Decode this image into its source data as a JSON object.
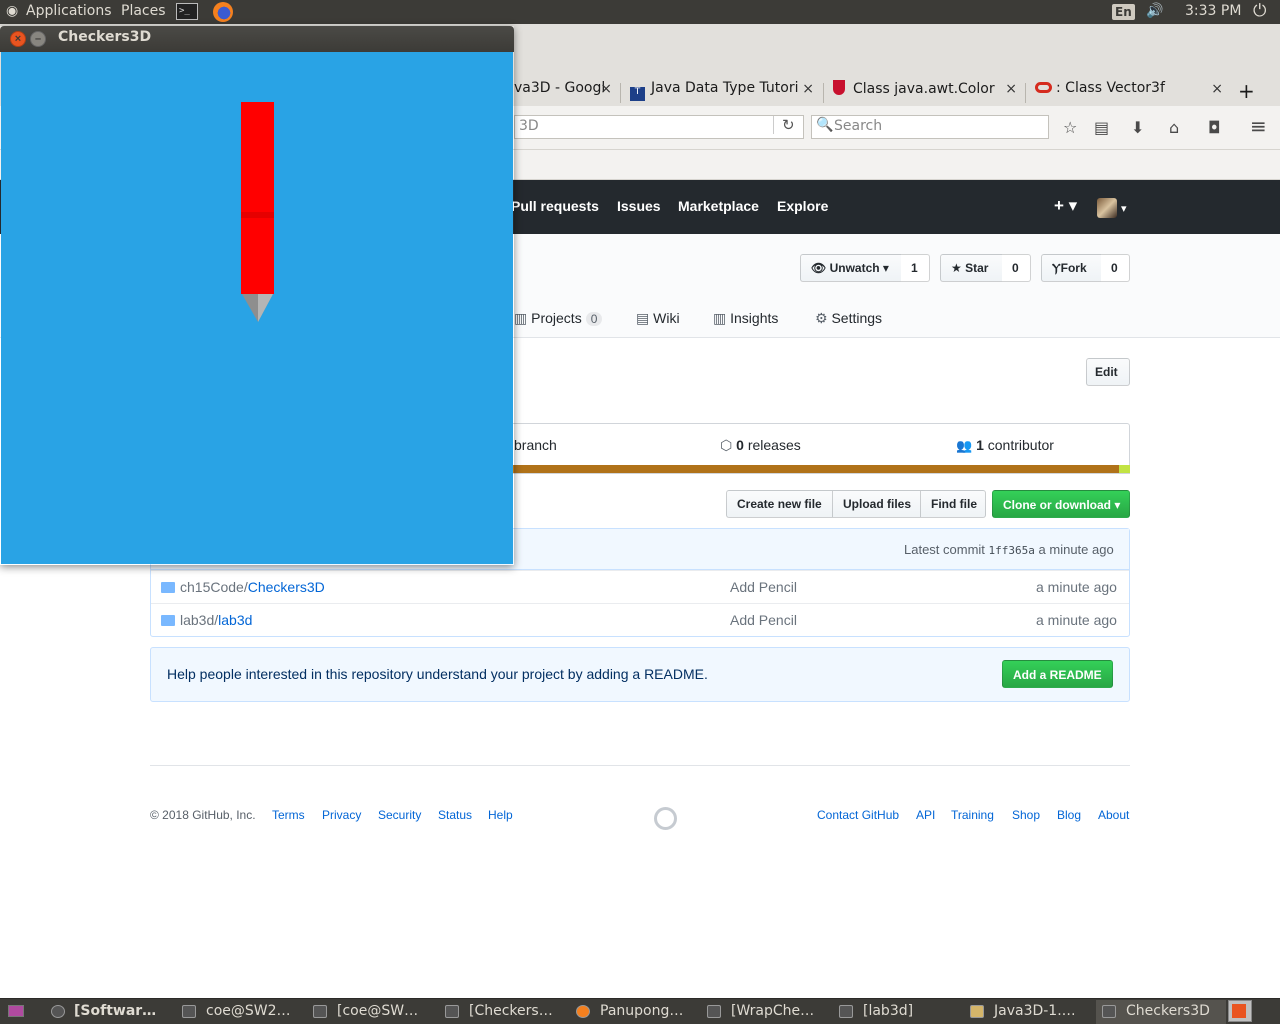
{
  "top_panel": {
    "applications": "Applications",
    "places": "Places",
    "terminal_glyph": ">_",
    "lang": "En",
    "volume_glyph": "🔊",
    "time": "3:33 PM",
    "power_glyph": "⏻"
  },
  "browser": {
    "tabs": [
      {
        "label": "va3D - Googl",
        "close": "×"
      },
      {
        "label": "Java Data Type Tutori",
        "close": "×"
      },
      {
        "label": "Class java.awt.Color",
        "close": "×"
      },
      {
        "label": ": Class Vector3f",
        "close": "×"
      }
    ],
    "new_tab": "+",
    "url_fragment": "3D",
    "reload_glyph": "↻",
    "search_placeholder": "Search",
    "toolbar_glyphs": {
      "star": "☆",
      "reading_list": "▤",
      "download": "⬇",
      "home": "⌂",
      "pocket": "◘",
      "menu": "≡"
    }
  },
  "github": {
    "nav": [
      "Pull requests",
      "Issues",
      "Marketplace",
      "Explore"
    ],
    "plus": "+ ▾",
    "avatar_caret": "▾",
    "unwatch": {
      "label": "Unwatch ▾",
      "count": "1",
      "glyph": "👁"
    },
    "star": {
      "label": "Star",
      "count": "0",
      "glyph": "★"
    },
    "fork": {
      "label": "Fork",
      "count": "0",
      "glyph": "Ⲩ"
    },
    "tabs": [
      {
        "label": "Projects",
        "count": "0",
        "glyph": "▥"
      },
      {
        "label": "Wiki",
        "glyph": "▤"
      },
      {
        "label": "Insights",
        "glyph": "▥"
      },
      {
        "label": "Settings",
        "glyph": "⚙"
      }
    ],
    "edit": "Edit",
    "summary": {
      "branch": "branch",
      "releases_count": "0",
      "releases": "releases",
      "contributor_count": "1",
      "contributor": "contributor",
      "tag_glyph": "⬡",
      "people_glyph": "👥"
    },
    "file_buttons": [
      "Create new file",
      "Upload files",
      "Find file"
    ],
    "clone_button": "Clone or download ▾",
    "latest_commit": {
      "label": "Latest commit",
      "sha": "1ff365a",
      "when": "a minute ago"
    },
    "files": [
      {
        "path_prefix": "ch15Code/",
        "name": "Checkers3D",
        "message": "Add Pencil",
        "age": "a minute ago"
      },
      {
        "path_prefix": "lab3d/",
        "name": "lab3d",
        "message": "Add Pencil",
        "age": "a minute ago"
      }
    ],
    "readme_prompt": "Help people interested in this repository understand your project by adding a README.",
    "add_readme": "Add a README",
    "footer": {
      "copyright": "© 2018 GitHub, Inc.",
      "left_links": [
        "Terms",
        "Privacy",
        "Security",
        "Status",
        "Help"
      ],
      "right_links": [
        "Contact GitHub",
        "API",
        "Training",
        "Shop",
        "Blog",
        "About"
      ]
    }
  },
  "java_window": {
    "title": "Checkers3D",
    "close_glyph": "×",
    "minimize_glyph": "–",
    "canvas_color": "#29a3e5",
    "pencil_color": "#ff0000"
  },
  "taskbar": {
    "items": [
      "[Softwar…",
      "coe@SW2…",
      "[coe@SW…",
      "[Checkers…",
      "Panupong…",
      "[WrapChe…",
      "[lab3d]",
      "Java3D-1.…",
      "Checkers3D"
    ]
  }
}
